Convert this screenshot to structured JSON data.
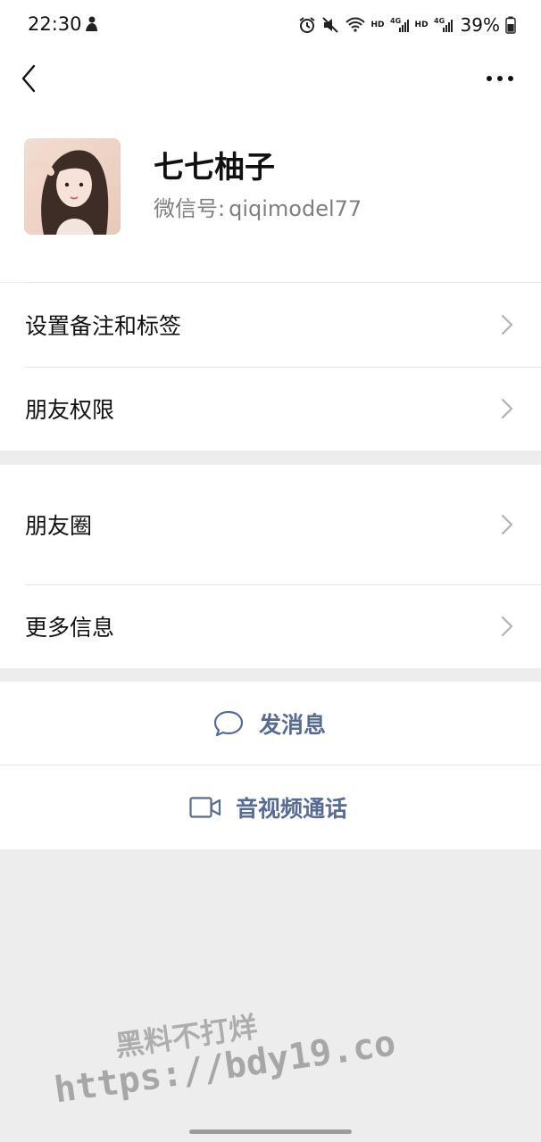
{
  "status_bar": {
    "time": "22:30",
    "battery": "39%",
    "icons": [
      "alarm-icon",
      "mute-icon",
      "wifi-icon",
      "signal-icon",
      "battery-icon"
    ],
    "network_labels": [
      "HD",
      "4G",
      "HD",
      "4G"
    ]
  },
  "nav": {
    "back_icon": "back-chevron-icon",
    "more_icon": "more-dots-icon"
  },
  "profile": {
    "name": "七七柚子",
    "wechat_id_label": "微信号:",
    "wechat_id": "qiqimodel77"
  },
  "menu": {
    "group1": [
      {
        "label": "设置备注和标签"
      },
      {
        "label": "朋友权限"
      }
    ],
    "group2": [
      {
        "label": "朋友圈"
      },
      {
        "label": "更多信息"
      }
    ]
  },
  "actions": {
    "message": {
      "label": "发消息",
      "icon": "chat-bubble-icon"
    },
    "video_call": {
      "label": "音视频通话",
      "icon": "video-camera-icon"
    }
  },
  "watermark": {
    "line1": "黑料不打烊",
    "line2": "https://bdy19.co"
  },
  "colors": {
    "link": "#576b95",
    "background": "#ededed",
    "secondary_text": "#7f7f7f"
  }
}
